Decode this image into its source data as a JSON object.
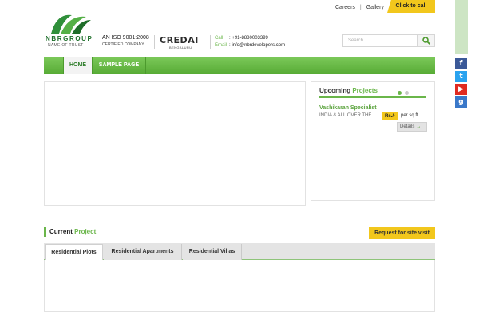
{
  "top_links": {
    "careers": "Careers",
    "separator": "|",
    "gallery": "Gallery",
    "call_button": "Click to call"
  },
  "logo": {
    "name": "NBRGROUP",
    "tagline": "NAME OF TRUST"
  },
  "iso": {
    "line1": "AN ISO 9001:2008",
    "line2": "CERTIFIED COMPANY"
  },
  "credai": {
    "name": "CREDAI",
    "city": "BENGALURU"
  },
  "contact": {
    "call_label": "Call",
    "call_value": ": +91-8880003399",
    "email_label": "Email",
    "email_value": ": info@nbrdevelopers.com"
  },
  "search": {
    "placeholder": "Search",
    "icon": "search-icon"
  },
  "nav": {
    "items": [
      {
        "label": "HOME",
        "active": true
      },
      {
        "label": "SAMPLE PAGE",
        "active": false
      }
    ]
  },
  "upcoming": {
    "title_plain": "Upcoming",
    "title_green": "Projects",
    "project_name": "Vashikaran Specialist",
    "location": "INDIA & ALL OVER THE...",
    "price_badge": "Rs./-",
    "price_unit": "per sq.ft",
    "details_button": "Details",
    "details_arrow": "→"
  },
  "current_project": {
    "title_plain": "Current",
    "title_green": "Project",
    "site_visit_button": "Request for site visit",
    "tabs": [
      {
        "label": "Residential Plots",
        "active": true
      },
      {
        "label": "Residential Apartments",
        "active": false
      },
      {
        "label": "Residential Villas",
        "active": false
      }
    ]
  },
  "social": [
    {
      "icon": "facebook-icon",
      "glyph": "f"
    },
    {
      "icon": "twitter-icon",
      "glyph": "t"
    },
    {
      "icon": "youtube-icon",
      "glyph": "▶"
    },
    {
      "icon": "google-plus-icon",
      "glyph": "g"
    }
  ],
  "colors": {
    "brand_green": "#6ab64a",
    "nav_green": "#57ab35",
    "accent_yellow": "#f2c71c"
  }
}
